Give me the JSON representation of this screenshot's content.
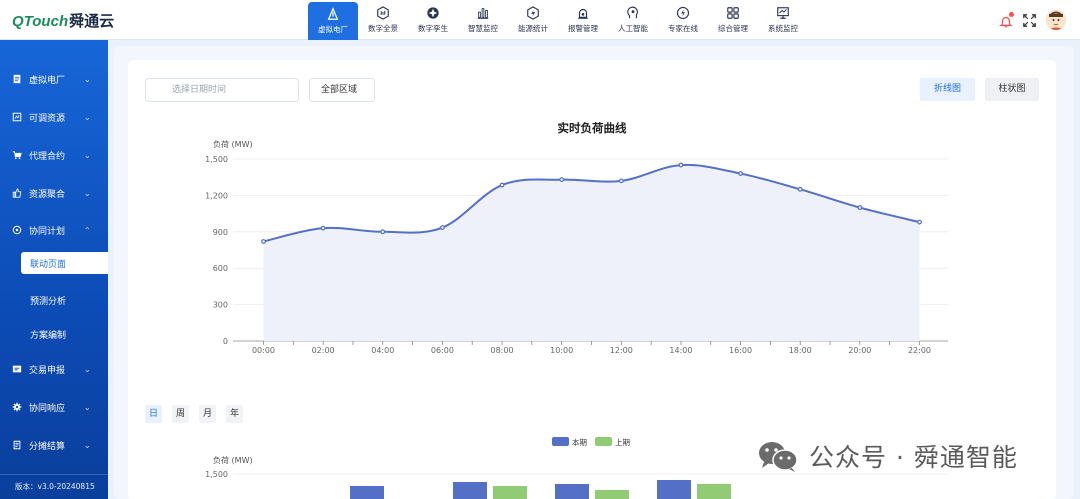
{
  "app": {
    "logo_brand": "QTouch",
    "logo_cn": "舜通云"
  },
  "nav": [
    {
      "label": "虚拟电厂",
      "icon": "power-plant-icon",
      "active": true
    },
    {
      "label": "数字全景",
      "icon": "panorama-icon"
    },
    {
      "label": "数字孪生",
      "icon": "twin-icon"
    },
    {
      "label": "智慧监控",
      "icon": "monitor-chart-icon"
    },
    {
      "label": "能源统计",
      "icon": "energy-icon"
    },
    {
      "label": "报警管理",
      "icon": "alarm-icon"
    },
    {
      "label": "人工智能",
      "icon": "ai-head-icon"
    },
    {
      "label": "专家在线",
      "icon": "expert-icon"
    },
    {
      "label": "综合管理",
      "icon": "grid-icon"
    },
    {
      "label": "系统监控",
      "icon": "system-monitor-icon"
    }
  ],
  "sidebar": {
    "items": [
      {
        "label": "虚拟电厂",
        "icon": "document-icon",
        "chevron": "⌄"
      },
      {
        "label": "可调资源",
        "icon": "resource-icon",
        "chevron": "⌄"
      },
      {
        "label": "代理合约",
        "icon": "cart-icon",
        "chevron": "⌄"
      },
      {
        "label": "资源聚合",
        "icon": "thumb-icon",
        "chevron": "⌄"
      },
      {
        "label": "协同计划",
        "icon": "plan-icon",
        "chevron": "⌃"
      },
      {
        "label": "交易申报",
        "icon": "trade-icon",
        "chevron": "⌄"
      },
      {
        "label": "协同响应",
        "icon": "gear-icon",
        "chevron": "⌄"
      },
      {
        "label": "分摊结算",
        "icon": "settle-icon",
        "chevron": "⌄"
      }
    ],
    "sub_items": [
      {
        "label": "联动页面",
        "active": true
      },
      {
        "label": "预测分析"
      },
      {
        "label": "方案编制"
      }
    ],
    "version": "版本：v3.0-20240815"
  },
  "filters": {
    "date_placeholder": "选择日期时间",
    "region": "全部区域",
    "line_button": "折线图",
    "bar_button": "柱状图"
  },
  "period_tabs": [
    "日",
    "周",
    "月",
    "年"
  ],
  "chart_data": [
    {
      "type": "area",
      "title": "实时负荷曲线",
      "ylabel": "负荷 (MW)",
      "ylim": [
        0,
        1500
      ],
      "yticks": [
        "0",
        "300",
        "600",
        "900",
        "1,200",
        "1,500"
      ],
      "categories": [
        "00:00",
        "02:00",
        "04:00",
        "06:00",
        "08:00",
        "10:00",
        "12:00",
        "14:00",
        "16:00",
        "18:00",
        "20:00",
        "22:00"
      ],
      "values": [
        820,
        930,
        900,
        935,
        1285,
        1330,
        1320,
        1450,
        1380,
        1250,
        1100,
        980
      ],
      "grid": true,
      "color": "#5470c6"
    },
    {
      "type": "bar",
      "ylabel": "负荷 (MW)",
      "yticks": [
        "1,500"
      ],
      "ylim": [
        0,
        1500
      ],
      "legend": [
        "本期",
        "上期"
      ],
      "colors": [
        "#5470c6",
        "#91cc75"
      ]
    }
  ],
  "watermark": "公众号 · 舜通智能"
}
